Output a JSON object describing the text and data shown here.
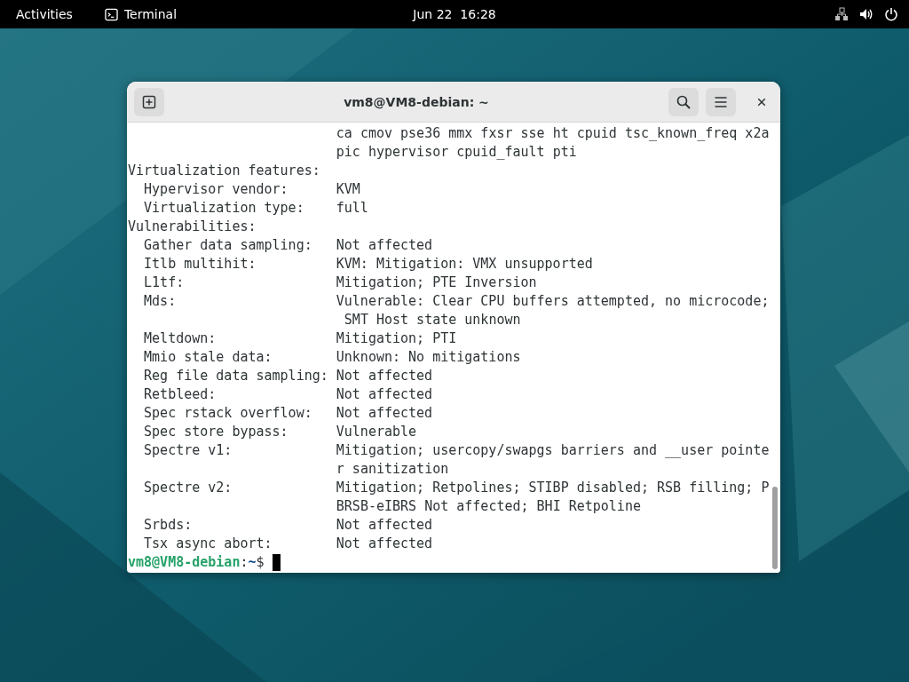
{
  "top_bar": {
    "activities": "Activities",
    "app_name": "Terminal",
    "clock": "Jun 22  16:28"
  },
  "window": {
    "title": "vm8@VM8-debian: ~"
  },
  "terminal": {
    "lines": [
      {
        "kind": "continuation",
        "value": "ca cmov pse36 mmx fxsr sse ht cpuid tsc_known_freq x2a"
      },
      {
        "kind": "continuation",
        "value": "pic hypervisor cpuid_fault pti"
      },
      {
        "kind": "section",
        "label": "Virtualization features:"
      },
      {
        "kind": "field",
        "label": "Hypervisor vendor:",
        "value": "KVM"
      },
      {
        "kind": "field",
        "label": "Virtualization type:",
        "value": "full"
      },
      {
        "kind": "section",
        "label": "Vulnerabilities:"
      },
      {
        "kind": "field",
        "label": "Gather data sampling:",
        "value": "Not affected"
      },
      {
        "kind": "field",
        "label": "Itlb multihit:",
        "value": "KVM: Mitigation: VMX unsupported"
      },
      {
        "kind": "field",
        "label": "L1tf:",
        "value": "Mitigation; PTE Inversion"
      },
      {
        "kind": "field",
        "label": "Mds:",
        "value": "Vulnerable: Clear CPU buffers attempted, no microcode;"
      },
      {
        "kind": "continuation",
        "value": " SMT Host state unknown"
      },
      {
        "kind": "field",
        "label": "Meltdown:",
        "value": "Mitigation; PTI"
      },
      {
        "kind": "field",
        "label": "Mmio stale data:",
        "value": "Unknown: No mitigations"
      },
      {
        "kind": "field",
        "label": "Reg file data sampling:",
        "value": "Not affected"
      },
      {
        "kind": "field",
        "label": "Retbleed:",
        "value": "Not affected"
      },
      {
        "kind": "field",
        "label": "Spec rstack overflow:",
        "value": "Not affected"
      },
      {
        "kind": "field",
        "label": "Spec store bypass:",
        "value": "Vulnerable"
      },
      {
        "kind": "field",
        "label": "Spectre v1:",
        "value": "Mitigation; usercopy/swapgs barriers and __user pointe"
      },
      {
        "kind": "continuation",
        "value": "r sanitization"
      },
      {
        "kind": "field",
        "label": "Spectre v2:",
        "value": "Mitigation; Retpolines; STIBP disabled; RSB filling; P"
      },
      {
        "kind": "continuation",
        "value": "BRSB-eIBRS Not affected; BHI Retpoline"
      },
      {
        "kind": "field",
        "label": "Srbds:",
        "value": "Not affected"
      },
      {
        "kind": "field",
        "label": "Tsx async abort:",
        "value": "Not affected"
      }
    ],
    "prompt": [
      {
        "kind": "user",
        "text": "vm8@VM8-debian"
      },
      {
        "kind": "plain",
        "text": ":"
      },
      {
        "kind": "path",
        "text": "~"
      },
      {
        "kind": "plain",
        "text": "$"
      }
    ]
  }
}
